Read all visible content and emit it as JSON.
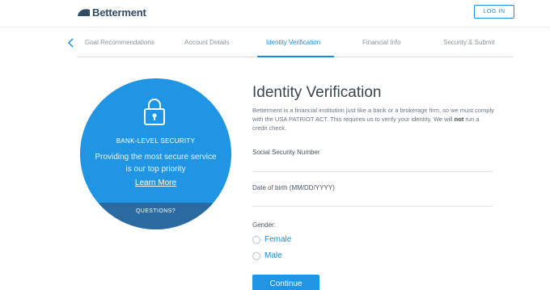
{
  "header": {
    "logo_text": "Betterment",
    "login_label": "LOG IN"
  },
  "nav": {
    "steps": [
      {
        "label": "Goal Recommendations"
      },
      {
        "label": "Account Details"
      },
      {
        "label": "Identity Verification",
        "active": true
      },
      {
        "label": "Financial Info"
      },
      {
        "label": "Security & Submit"
      }
    ]
  },
  "security_panel": {
    "title": "BANK-LEVEL SECURITY",
    "description": "Providing the most secure service is our top priority",
    "link": "Learn More",
    "footer": "QUESTIONS?"
  },
  "form": {
    "title": "Identity Verification",
    "description_before": "Betterment is a financial institution just like a bank or a brokerage firm, so we must comply with the USA PATRIOT ACT. This requires us to verify your identity. We will ",
    "description_bold": "not",
    "description_after": " run a credit check.",
    "ssn_label": "Social Security Number",
    "dob_label": "Date of birth (MM/DD/YYYY)",
    "gender_label": "Gender:",
    "gender_options": [
      "Female",
      "Male"
    ],
    "continue_label": "Continue"
  },
  "colors": {
    "accent": "#1a8cd8",
    "panel": "#1f95e3",
    "panel_footer": "#2a6aa0"
  }
}
